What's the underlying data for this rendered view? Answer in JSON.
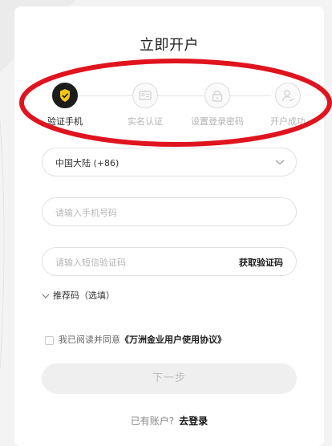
{
  "title": "立即开户",
  "steps": [
    {
      "label": "验证手机",
      "icon": "shield-icon",
      "active": true
    },
    {
      "label": "实名认证",
      "icon": "id-card-icon",
      "active": false
    },
    {
      "label": "设置登录密码",
      "icon": "lock-icon",
      "active": false
    },
    {
      "label": "开户成功",
      "icon": "user-check-icon",
      "active": false
    }
  ],
  "region_select": {
    "value": "中国大陆 (+86)"
  },
  "phone_input": {
    "placeholder": "请输入手机号码"
  },
  "sms_input": {
    "placeholder": "请输入短信验证码",
    "action": "获取验证码"
  },
  "referral": {
    "label": "推荐码（选填）"
  },
  "agreement": {
    "prefix": "我已阅读并同意",
    "link": "《万洲金业用户使用协议》"
  },
  "next_button": {
    "label": "下一步"
  },
  "login": {
    "prompt": "已有账户?",
    "link": "去登录"
  },
  "colors": {
    "accent": "#f5c518",
    "annotation": "#e0141e",
    "active_step": "#1c1c1c"
  }
}
